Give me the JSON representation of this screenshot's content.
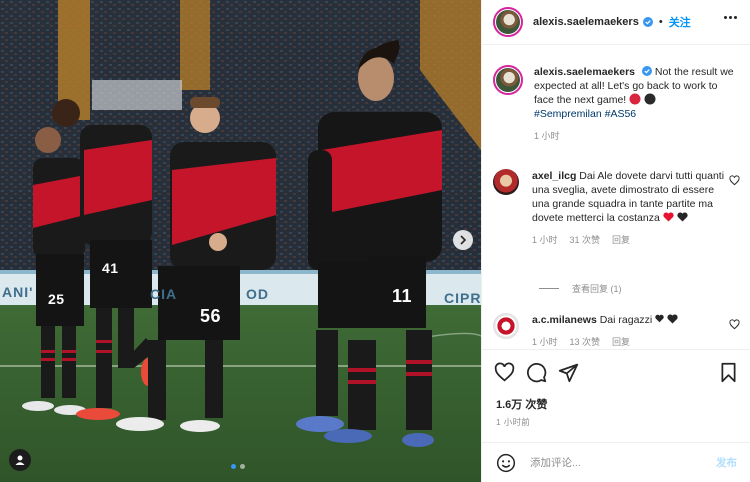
{
  "media": {
    "ad_boards": [
      "ANI'",
      "CIA",
      "OD",
      "CIPR"
    ],
    "jersey_numbers": [
      "25",
      "41",
      "56",
      "11"
    ],
    "carousel": {
      "total": 2,
      "active": 1
    }
  },
  "header": {
    "username": "alexis.saelemaekers",
    "separator": "•",
    "follow_label": "关注"
  },
  "caption": {
    "username": "alexis.saelemaekers",
    "text": "Not the result we expected at all! Let's go back to work to face the next game!",
    "hashtags": "#Sempremilan #AS56",
    "time": "1 小时"
  },
  "comments": [
    {
      "username": "axel_ilcg",
      "text": "Dai Ale dovete darvi tutti quanti una sveglia, avete dimostrato di essere una grande squadra in tante partite ma dovete metterci la costanza",
      "time": "1 小时",
      "likes": "31 次赞",
      "reply_label": "回复"
    },
    {
      "username": "a.c.milanews",
      "text": "Dai ragazzi",
      "time": "1 小时",
      "likes": "13 次赞",
      "reply_label": "回复"
    }
  ],
  "view_replies_label": "查看回复 (1)",
  "likes_count": "1.6万 次赞",
  "posted_ago": "1 小时前",
  "add_comment": {
    "placeholder": "添加评论...",
    "post_label": "发布"
  },
  "colors": {
    "follow": "#0095f6",
    "verified": "#3897f0",
    "heart_red": "#e8132f"
  }
}
